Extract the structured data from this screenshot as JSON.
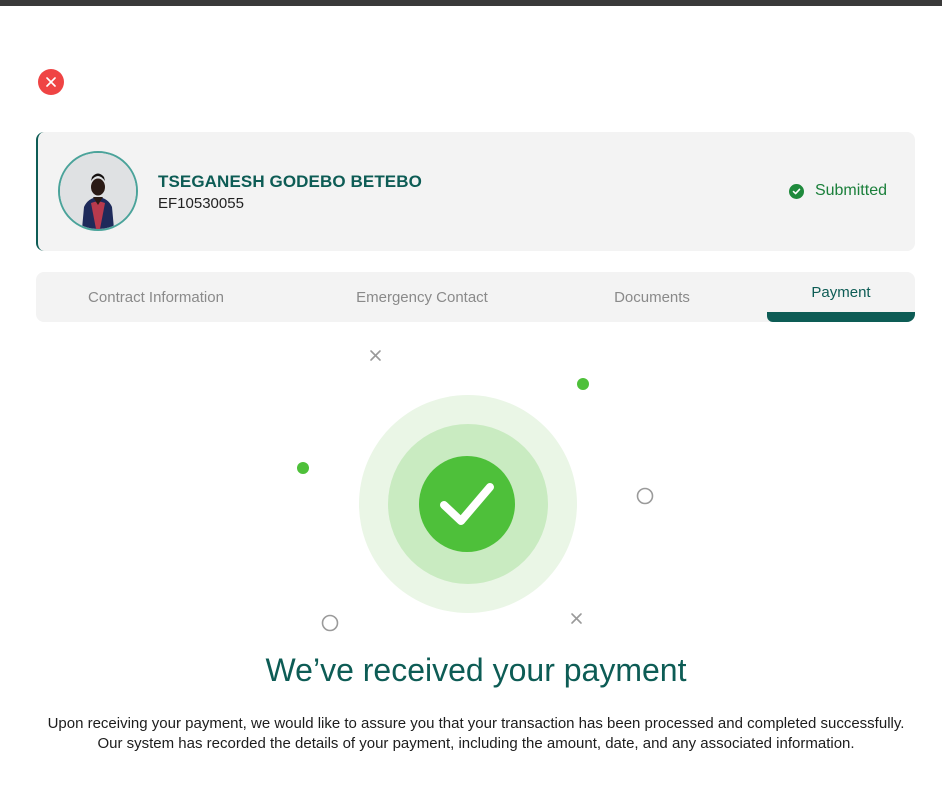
{
  "modal": {
    "close_icon": "close-icon"
  },
  "profile": {
    "name": "TSEGANESH GODEBO BETEBO",
    "id": "EF10530055",
    "status": "Submitted",
    "status_icon": "check-circle-icon",
    "avatar_icon": "avatar-photo"
  },
  "tabs": [
    {
      "label": "Contract Information",
      "active": false
    },
    {
      "label": "Emergency Contact",
      "active": false
    },
    {
      "label": "Documents",
      "active": false
    },
    {
      "label": "Payment",
      "active": true
    }
  ],
  "success": {
    "icon": "check-icon",
    "title": "We’ve received your payment",
    "message": "Upon receiving your payment, we would like to assure you that your transaction has been processed and completed successfully. Our system has recorded the details of your payment, including the amount, date, and any associated information."
  },
  "colors": {
    "brand": "#0d5c55",
    "success": "#4ec03a",
    "danger": "#ef4444"
  }
}
